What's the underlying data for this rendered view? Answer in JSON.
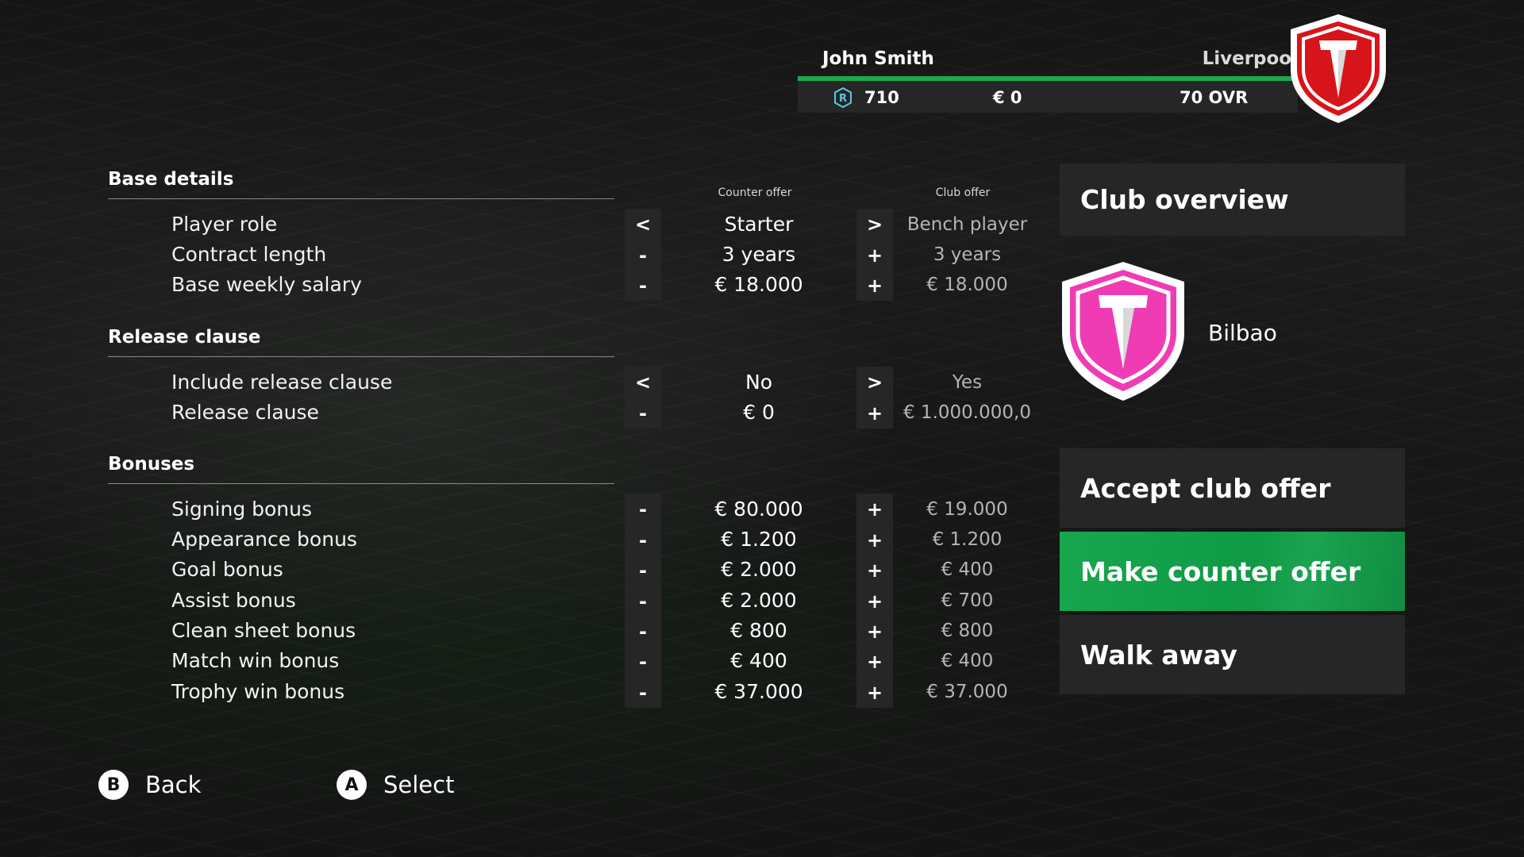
{
  "header": {
    "player_name": "John Smith",
    "club_name": "Liverpool",
    "reputation": "710",
    "money": "€ 0",
    "ovr": "70 OVR",
    "icons": {
      "reputation": "reputation-r-icon",
      "club_crest": "shield-crest-icon"
    },
    "colors": {
      "accent_green": "#1ea84e",
      "liverpool_crest": "#d8141b"
    }
  },
  "columns": {
    "counter_header": "Counter offer",
    "club_header": "Club offer"
  },
  "sections": {
    "base": {
      "title": "Base details",
      "rows": [
        {
          "label": "Player role",
          "dec": "<",
          "counter": "Starter",
          "inc": ">",
          "club": "Bench player"
        },
        {
          "label": "Contract length",
          "dec": "-",
          "counter": "3 years",
          "inc": "+",
          "club": "3 years"
        },
        {
          "label": "Base weekly salary",
          "dec": "-",
          "counter": "€ 18.000",
          "inc": "+",
          "club": "€ 18.000"
        }
      ]
    },
    "release": {
      "title": "Release clause",
      "rows": [
        {
          "label": "Include release clause",
          "dec": "<",
          "counter": "No",
          "inc": ">",
          "club": "Yes"
        },
        {
          "label": "Release clause",
          "dec": "-",
          "counter": "€ 0",
          "inc": "+",
          "club": "€ 1.000.000,0"
        }
      ]
    },
    "bonuses": {
      "title": "Bonuses",
      "rows": [
        {
          "label": "Signing bonus",
          "dec": "-",
          "counter": "€ 80.000",
          "inc": "+",
          "club": "€ 19.000"
        },
        {
          "label": "Appearance bonus",
          "dec": "-",
          "counter": "€ 1.200",
          "inc": "+",
          "club": "€ 1.200"
        },
        {
          "label": "Goal bonus",
          "dec": "-",
          "counter": "€ 2.000",
          "inc": "+",
          "club": "€ 400"
        },
        {
          "label": "Assist bonus",
          "dec": "-",
          "counter": "€ 2.000",
          "inc": "+",
          "club": "€ 700"
        },
        {
          "label": "Clean sheet bonus",
          "dec": "-",
          "counter": "€ 800",
          "inc": "+",
          "club": "€ 800"
        },
        {
          "label": "Match win bonus",
          "dec": "-",
          "counter": "€ 400",
          "inc": "+",
          "club": "€ 400"
        },
        {
          "label": "Trophy win bonus",
          "dec": "-",
          "counter": "€ 37.000",
          "inc": "+",
          "club": "€ 37.000"
        }
      ]
    }
  },
  "panel": {
    "club_overview": "Club overview",
    "club_name": "Bilbao",
    "accept": "Accept club offer",
    "counter": "Make counter offer",
    "walk_away": "Walk away",
    "colors": {
      "bilbao_crest": "#f03cb4",
      "active_button": "#17a74f"
    }
  },
  "footer": {
    "back_key": "B",
    "back_label": "Back",
    "select_key": "A",
    "select_label": "Select"
  }
}
